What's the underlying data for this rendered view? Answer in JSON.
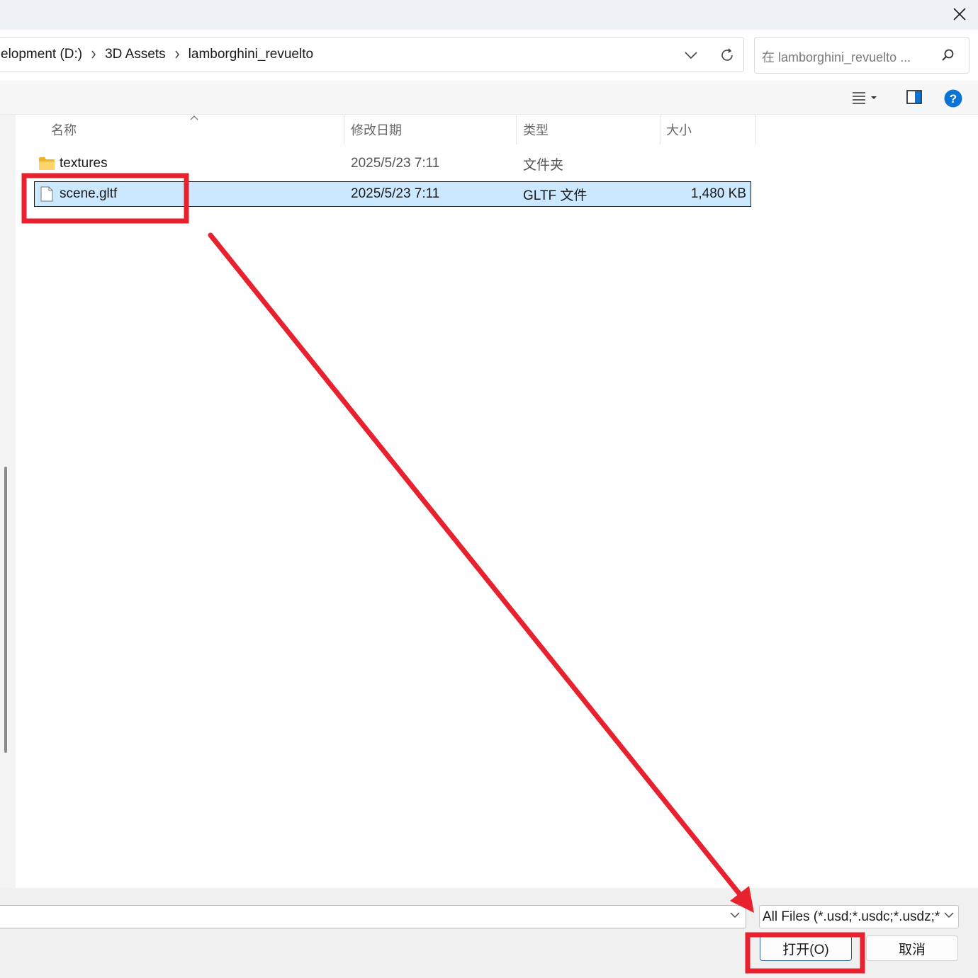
{
  "titlebar": {
    "close_icon": "close-icon"
  },
  "address": {
    "crumbs": [
      "elopment (D:)",
      "3D Assets",
      "lamborghini_revuelto"
    ],
    "dropdown_icon": "chevron-down-icon",
    "refresh_icon": "refresh-icon"
  },
  "search": {
    "placeholder": "在 lamborghini_revuelto ...",
    "icon": "search-icon"
  },
  "toolbar": {
    "view_icon": "details-view-icon",
    "preview_icon": "preview-pane-icon",
    "help_icon": "help-icon"
  },
  "columns": {
    "name": "名称",
    "date": "修改日期",
    "type": "类型",
    "size": "大小"
  },
  "files": [
    {
      "name": "textures",
      "date": "2025/5/23 7:11",
      "type": "文件夹",
      "size": "",
      "icon": "folder-icon",
      "selected": false
    },
    {
      "name": "scene.gltf",
      "date": "2025/5/23 7:11",
      "type": "GLTF 文件",
      "size": "1,480 KB",
      "icon": "file-icon",
      "selected": true
    }
  ],
  "bottom": {
    "filename_value": "",
    "filter": "All Files (*.usd;*.usdc;*.usdz;*.",
    "open_label": "打开(O)",
    "cancel_label": "取消"
  },
  "annotations": {
    "color": "#e8212e",
    "items": [
      "highlight-box-file",
      "arrow",
      "highlight-box-open"
    ]
  }
}
